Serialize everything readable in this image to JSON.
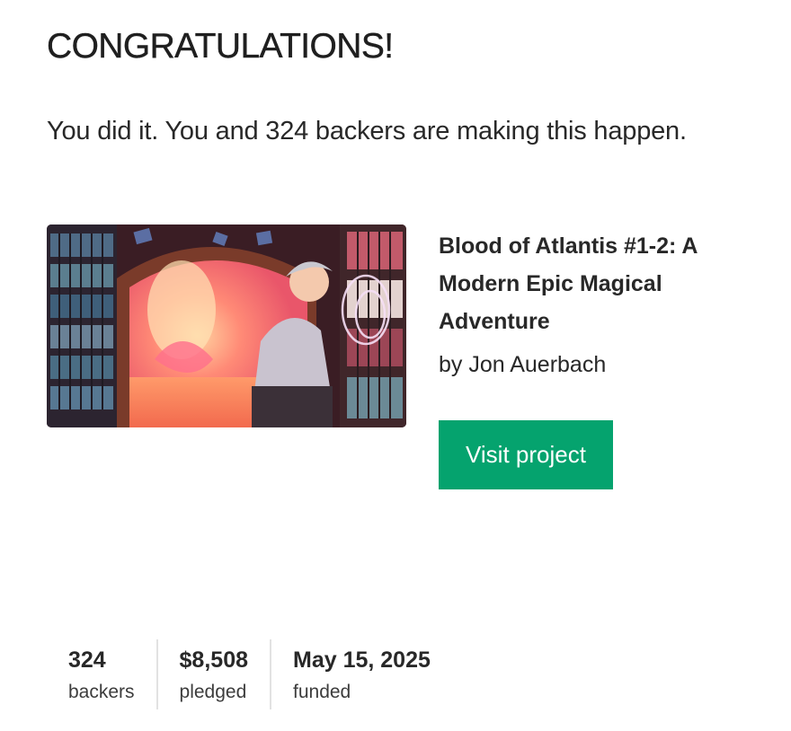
{
  "header": {
    "headline": "CONGRATULATIONS!",
    "message": "You did it. You and 324 backers are making this happen."
  },
  "project": {
    "title": "Blood of Atlantis #1-2: A Modern Epic Magical Adventure",
    "creator": "by Jon Auerbach",
    "cta_label": "Visit project",
    "cta_color": "#05a36e"
  },
  "stats": [
    {
      "value": "324",
      "label": "backers"
    },
    {
      "value": "$8,508",
      "label": "pledged"
    },
    {
      "value": "May 15, 2025",
      "label": "funded"
    }
  ]
}
